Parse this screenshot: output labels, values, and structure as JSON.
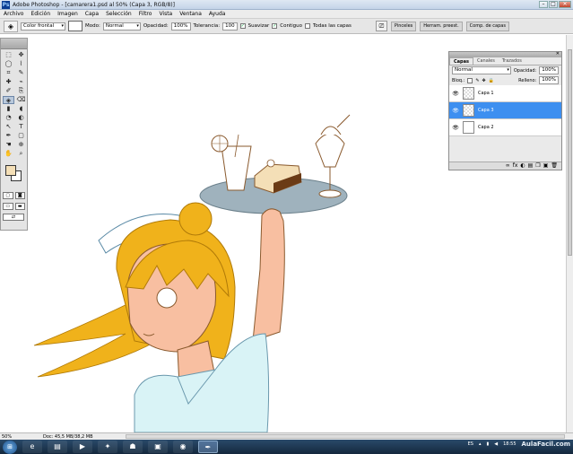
{
  "window": {
    "title": "Adobe Photoshop - [camarera1.psd al 50% (Capa 3, RGB/8)]",
    "app_icon": "Ps",
    "buttons": [
      "–",
      "□",
      "✕"
    ]
  },
  "menu": [
    "Archivo",
    "Edición",
    "Imagen",
    "Capa",
    "Selección",
    "Filtro",
    "Vista",
    "Ventana",
    "Ayuda"
  ],
  "options": {
    "fill_source": "Color frontal",
    "mode_label": "Modo:",
    "mode_value": "Normal",
    "opacity_label": "Opacidad:",
    "opacity_value": "100%",
    "tolerance_label": "Tolerancia:",
    "tolerance_value": "100",
    "antialias_label": "Suavizar",
    "contiguous_label": "Contiguo",
    "all_layers_label": "Todas las capas",
    "dock_tabs": [
      "Pinceles",
      "Herram. preest.",
      "Comp. de capas"
    ]
  },
  "toolbox": {
    "tools": [
      "⬚",
      "✥",
      "◯",
      "⌇",
      "⌗",
      "✎",
      "✚",
      "⌁",
      "✐",
      "⎘",
      "◈",
      "⌫",
      "▮",
      "◖",
      "◔",
      "◐",
      "↖",
      "T",
      "✒",
      "▢",
      "☚",
      "⊕",
      "✋",
      "⌕"
    ],
    "fg_color": "#f4dfb7",
    "bg_color": "#ffffff"
  },
  "layers_panel": {
    "tabs": [
      "Capas",
      "Canales",
      "Trazados"
    ],
    "blend_mode": "Normal",
    "opacity_label": "Opacidad:",
    "opacity_value": "100%",
    "lock_label": "Bloq.:",
    "fill_label": "Relleno:",
    "fill_value": "100%",
    "layers": [
      {
        "name": "Capa 1",
        "visible": true,
        "selected": false
      },
      {
        "name": "Capa 3",
        "visible": true,
        "selected": true
      },
      {
        "name": "Capa 2",
        "visible": true,
        "selected": false
      }
    ],
    "footer_icons": [
      "∞",
      "fx",
      "◐",
      "▤",
      "❒",
      "▣",
      "🗑"
    ]
  },
  "status": {
    "zoom": "50%",
    "doc_info": "Doc: 45,5 MB/38,2 MB"
  },
  "taskbar": {
    "language": "ES",
    "time": "18:55",
    "watermark": "AulaFacil.com"
  },
  "colors": {
    "hair": "#f0b21b",
    "skin": "#f8bfa1",
    "uniform": "#d9f3f6",
    "tray": "#9fb2bd",
    "line": "#8a5a2e"
  }
}
